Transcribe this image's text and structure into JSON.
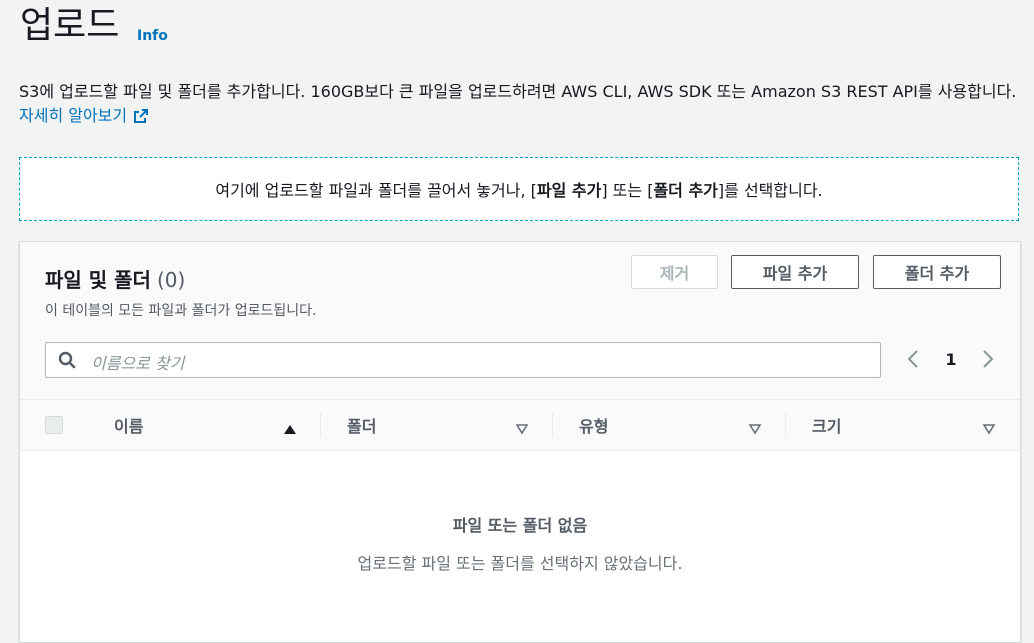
{
  "page": {
    "title": "업로드",
    "info_link": "Info",
    "description": "S3에 업로드할 파일 및 폴더를 추가합니다. 160GB보다 큰 파일을 업로드하려면 AWS CLI, AWS SDK 또는 Amazon S3 REST API를 사용합니다.",
    "learn_more": "자세히 알아보기"
  },
  "dropzone": {
    "prefix": "여기에 업로드할 파일과 폴더를 끌어서 놓거나, [",
    "add_files": "파일 추가",
    "middle": "] 또는 [",
    "add_folder": "폴더 추가",
    "suffix": "]를 선택합니다."
  },
  "panel": {
    "title": "파일 및 폴더",
    "count": "(0)",
    "description": "이 테이블의 모든 파일과 폴더가 업로드됩니다.",
    "buttons": {
      "remove": "제거",
      "add_files": "파일 추가",
      "add_folder": "폴더 추가"
    },
    "search": {
      "placeholder": "이름으로 찾기"
    },
    "pagination": {
      "current_page": "1"
    },
    "columns": [
      "이름",
      "폴더",
      "유형",
      "크기"
    ],
    "empty_state": {
      "title": "파일 또는 폴더 없음",
      "description": "업로드할 파일 또는 폴더를 선택하지 않았습니다."
    }
  },
  "icons": {
    "external_link": "external-link-icon",
    "search": "search-icon",
    "prev": "chevron-left-icon",
    "next": "chevron-right-icon",
    "sort_asc": "sort-ascending-icon",
    "sort": "sort-descending-icon"
  },
  "colors": {
    "link": "#0073bb",
    "dropzone_border": "#00a1c9",
    "background": "#f2f3f3"
  }
}
